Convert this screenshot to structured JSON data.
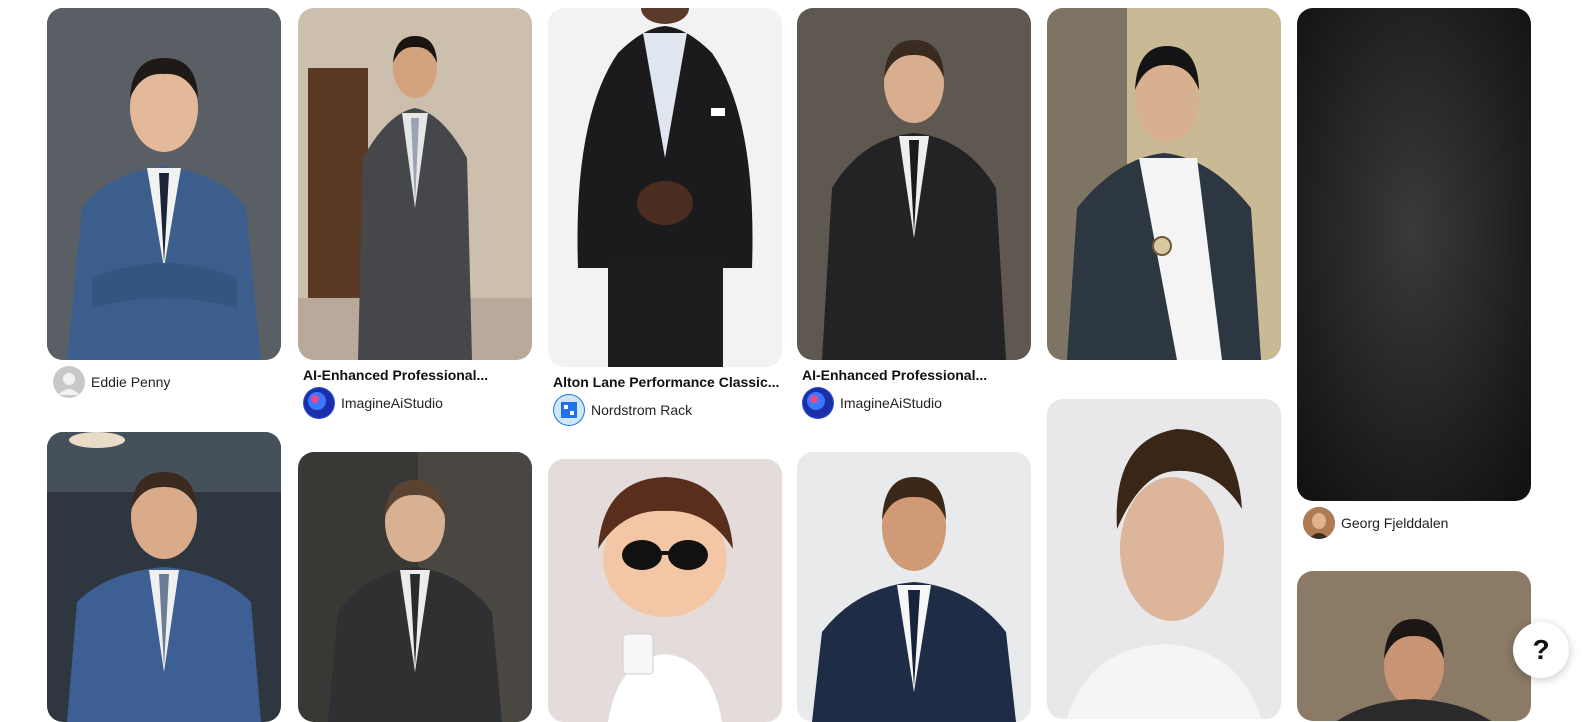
{
  "pins": [
    {
      "author": "Eddie Penny"
    },
    {
      "title": "AI-Enhanced Professional...",
      "author": "ImagineAiStudio"
    },
    {
      "title": "Alton Lane Performance Classic...",
      "author": "Nordstrom Rack"
    },
    {
      "title": "AI-Enhanced Professional...",
      "author": "ImagineAiStudio"
    },
    {
      "author": "Georg Fjelddalen"
    }
  ],
  "help_label": "?",
  "colors": {
    "background": "#ffffff",
    "text": "#111111",
    "avatar_default": "#c8c8c8",
    "imagine_avatar": "#2a4fd8",
    "nordstrom_avatar": "#1e73e8"
  }
}
